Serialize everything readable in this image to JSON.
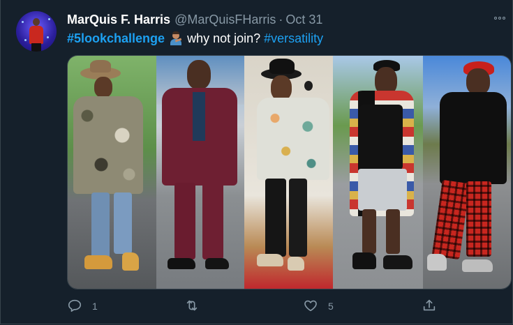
{
  "tweet": {
    "author_name": "MarQuis F. Harris",
    "author_handle": "@MarQuisFHarris",
    "separator": "·",
    "date": "Oct 31",
    "text_parts": {
      "hashtag1": "#5lookchallenge",
      "middle": "why not join?",
      "hashtag2": "#versatility"
    },
    "emoji": "man-shrugging-emoji"
  },
  "media": {
    "photo_count": 5,
    "photos": [
      {
        "label": "look-1-camo-jacket"
      },
      {
        "label": "look-2-burgundy-suit"
      },
      {
        "label": "look-3-floral-shirt"
      },
      {
        "label": "look-4-patchwork-vest"
      },
      {
        "label": "look-5-plaid-pants"
      }
    ]
  },
  "actions": {
    "reply_count": "1",
    "retweet_count": "",
    "like_count": "5",
    "icons": [
      "reply-icon",
      "retweet-icon",
      "like-icon",
      "share-icon"
    ]
  },
  "colors": {
    "background": "#15202b",
    "accent": "#1da1f2",
    "muted": "#8899a6",
    "border": "#38444d"
  }
}
